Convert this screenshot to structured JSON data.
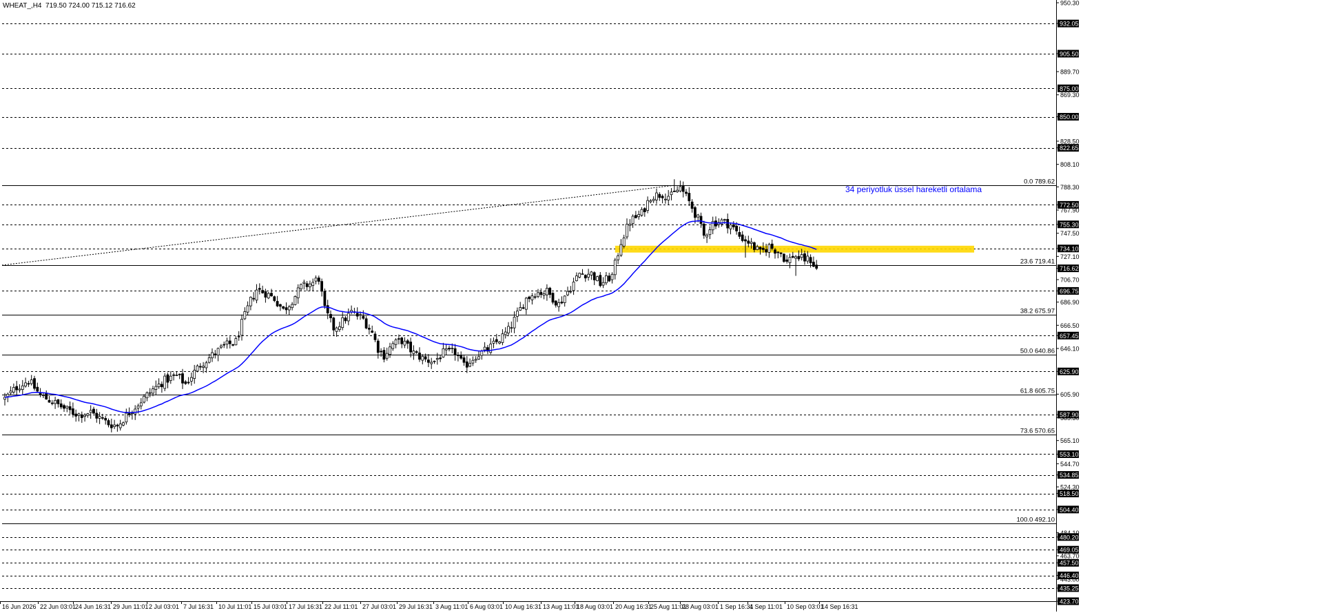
{
  "header": {
    "symbol": "WHEAT_",
    "timeframe": "H4",
    "ohlc": "719.50 724.00 715.12 716.62",
    "title": "WHEAT_,H4  719.50 724.00 715.12 716.62"
  },
  "colors": {
    "background": "#ffffff",
    "candle": "#000000",
    "ema_line": "#0000ff",
    "ema_label": "#0000ff",
    "zone": "#ffd700",
    "price_tag_bg": "#000000",
    "price_tag_text": "#ffffff",
    "gridline": "#000000"
  },
  "chart_data": {
    "type": "candlestick",
    "ylim": [
      423.7,
      950.3
    ],
    "y_axis_labels": [
      "950.30",
      "932.05",
      "905.50",
      "889.70",
      "869.30",
      "850.00",
      "828.50",
      "822.65",
      "808.10",
      "788.30",
      "772.50",
      "767.90",
      "755.30",
      "747.50",
      "734.10",
      "727.10",
      "716.62",
      "706.70",
      "696.75",
      "686.90",
      "666.50",
      "657.45",
      "646.10",
      "625.90",
      "605.90",
      "587.90",
      "585.30",
      "565.10",
      "553.10",
      "544.70",
      "534.85",
      "524.30",
      "518.50",
      "504.40",
      "484.10",
      "480.20",
      "469.05",
      "463.70",
      "457.50",
      "446.40",
      "443.00",
      "435.25",
      "423.70"
    ],
    "dashed_levels": [
      932.05,
      905.5,
      875.0,
      850.0,
      822.65,
      772.5,
      755.3,
      734.1,
      696.75,
      657.45,
      625.9,
      587.9,
      553.1,
      534.85,
      518.5,
      504.4,
      480.2,
      469.05,
      457.5,
      446.4,
      435.25
    ],
    "tagged_levels": [
      "932.05",
      "905.50",
      "875.00",
      "850.00",
      "822.65",
      "772.50",
      "755.30",
      "734.10",
      "716.62",
      "696.75",
      "657.45",
      "625.90",
      "587.90",
      "553.10",
      "534.85",
      "518.50",
      "504.40",
      "480.20",
      "469.05",
      "457.50",
      "446.40",
      "435.25",
      "423.70"
    ],
    "current_price": 716.62,
    "fibonacci": {
      "levels": [
        {
          "label": "0.0 789.62",
          "value": 789.62
        },
        {
          "label": "23.6 719.41",
          "value": 719.41
        },
        {
          "label": "38.2 675.97",
          "value": 675.97
        },
        {
          "label": "50.0 640.86",
          "value": 640.86
        },
        {
          "label": "61.8 605.75",
          "value": 605.75
        },
        {
          "label": "73.6 570.65",
          "value": 570.65
        },
        {
          "label": "100.0 492.10",
          "value": 492.1
        }
      ]
    },
    "zone": {
      "low": 730.5,
      "high": 736.5
    },
    "annotation": "34 periyotluk üssel hareketli ortalama",
    "x_labels": [
      "16 Jun 2026",
      "22 Jun 03:01",
      "24 Jun 16:31",
      "29 Jun 11:01",
      "2 Jul 03:01",
      "7 Jul 16:31",
      "10 Jul 11:01",
      "15 Jul 03:01",
      "17 Jul 16:31",
      "22 Jul 11:01",
      "27 Jul 03:01",
      "29 Jul 16:31",
      "3 Aug 11:01",
      "6 Aug 03:01",
      "10 Aug 16:31",
      "13 Aug 11:01",
      "18 Aug 03:01",
      "20 Aug 16:31",
      "25 Aug 11:01",
      "28 Aug 03:01",
      "1 Sep 16:31",
      "4 Sep 11:01",
      "10 Sep 03:01",
      "14 Sep 16:31"
    ],
    "price_path": [
      [
        0,
        602
      ],
      [
        4,
        612
      ],
      [
        8,
        618
      ],
      [
        12,
        605
      ],
      [
        17,
        598
      ],
      [
        21,
        592
      ],
      [
        25,
        588
      ],
      [
        29,
        590
      ],
      [
        32,
        585
      ],
      [
        35,
        580
      ],
      [
        38,
        578
      ],
      [
        42,
        590
      ],
      [
        46,
        600
      ],
      [
        50,
        610
      ],
      [
        54,
        618
      ],
      [
        58,
        622
      ],
      [
        61,
        615
      ],
      [
        63,
        622
      ],
      [
        66,
        632
      ],
      [
        70,
        640
      ],
      [
        74,
        648
      ],
      [
        78,
        652
      ],
      [
        80,
        668
      ],
      [
        83,
        688
      ],
      [
        85,
        698
      ],
      [
        88,
        695
      ],
      [
        91,
        690
      ],
      [
        94,
        680
      ],
      [
        96,
        685
      ],
      [
        100,
        700
      ],
      [
        104,
        704
      ],
      [
        106,
        708
      ],
      [
        108,
        680
      ],
      [
        111,
        664
      ],
      [
        114,
        670
      ],
      [
        117,
        678
      ],
      [
        121,
        672
      ],
      [
        124,
        660
      ],
      [
        126,
        646
      ],
      [
        128,
        640
      ],
      [
        131,
        650
      ],
      [
        134,
        653
      ],
      [
        138,
        642
      ],
      [
        142,
        636
      ],
      [
        145,
        635
      ],
      [
        148,
        642
      ],
      [
        152,
        643
      ],
      [
        155,
        630
      ],
      [
        159,
        640
      ],
      [
        163,
        645
      ],
      [
        167,
        654
      ],
      [
        170,
        662
      ],
      [
        173,
        676
      ],
      [
        176,
        690
      ],
      [
        179,
        695
      ],
      [
        183,
        696
      ],
      [
        187,
        685
      ],
      [
        191,
        700
      ],
      [
        194,
        712
      ],
      [
        198,
        712
      ],
      [
        201,
        703
      ],
      [
        205,
        710
      ],
      [
        208,
        740
      ],
      [
        211,
        758
      ],
      [
        215,
        765
      ],
      [
        218,
        780
      ],
      [
        222,
        782
      ],
      [
        225,
        780
      ],
      [
        228,
        788
      ],
      [
        231,
        775
      ],
      [
        234,
        760
      ],
      [
        236,
        745
      ],
      [
        239,
        757
      ],
      [
        242,
        758
      ],
      [
        245,
        755
      ],
      [
        248,
        745
      ],
      [
        251,
        740
      ],
      [
        255,
        730
      ],
      [
        258,
        736
      ],
      [
        262,
        730
      ],
      [
        264,
        722
      ],
      [
        266,
        728
      ],
      [
        269,
        725
      ],
      [
        272,
        724
      ],
      [
        274,
        716
      ]
    ],
    "highlights": [
      {
        "i": 10,
        "hi": 622
      },
      {
        "i": 226,
        "hi": 795
      },
      {
        "i": 267,
        "lo": 710
      },
      {
        "i": 250,
        "lo": 726
      }
    ],
    "ema_period": 34,
    "x_reference_points": [
      [
        0,
        0
      ],
      [
        12,
        55
      ],
      [
        32,
        106
      ],
      [
        47,
        161
      ],
      [
        62,
        213
      ],
      [
        77,
        263
      ],
      [
        89,
        314
      ],
      [
        104,
        365
      ],
      [
        119,
        416
      ],
      [
        134,
        468
      ],
      [
        148,
        523
      ],
      [
        160,
        576
      ],
      [
        174,
        629
      ],
      [
        189,
        679
      ],
      [
        203,
        730
      ],
      [
        218,
        785
      ],
      [
        233,
        834
      ],
      [
        246,
        890
      ],
      [
        260,
        941
      ],
      [
        275,
        987
      ],
      [
        290,
        1042
      ],
      [
        301,
        1085
      ],
      [
        319,
        1139
      ],
      [
        332,
        1189
      ]
    ]
  }
}
